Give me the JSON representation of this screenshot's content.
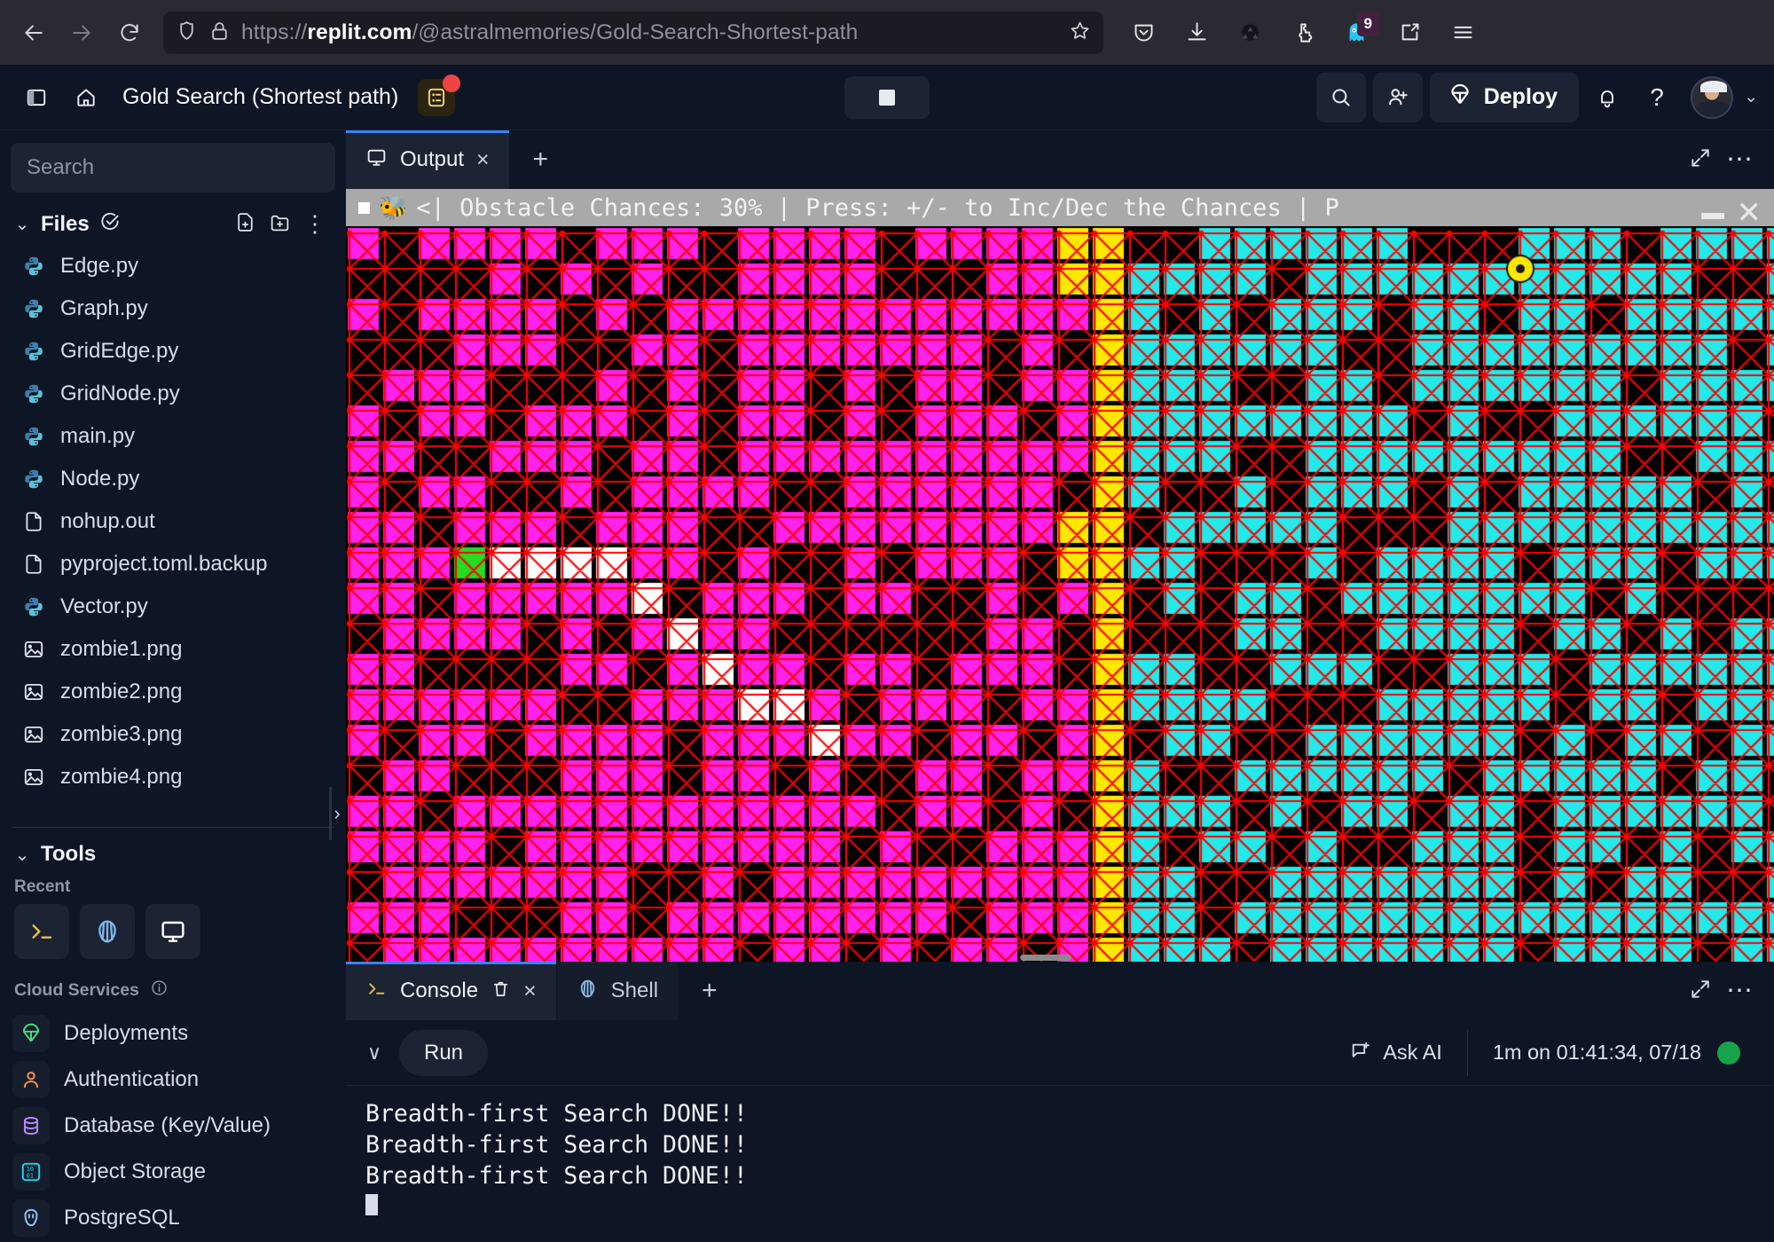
{
  "browser": {
    "url_prefix": "https://",
    "url_domain": "replit.com",
    "url_path": "/@astralmemories/Gold-Search-Shortest-path",
    "url_full": "https://replit.com/@astralmemories/Gold-Search-Shortest-path",
    "back_icon": "back-arrow-icon",
    "forward_icon": "forward-arrow-icon",
    "reload_icon": "reload-icon",
    "shield_icon": "shield-icon",
    "lock_icon": "lock-icon",
    "star_icon": "bookmark-star-icon",
    "toolbar_icons": [
      "pocket-icon",
      "download-icon",
      "extension-circle-icon",
      "puzzle-extensions-icon",
      "ghost-proxy-icon",
      "open-in-new-icon",
      "hamburger-menu-icon"
    ],
    "ghost_badge": "9"
  },
  "header": {
    "sidebar_toggle_icon": "sidebar-toggle-icon",
    "home_icon": "home-icon",
    "title": "Gold Search (Shortest path)",
    "changes_icon": "git-changes-icon",
    "stop_icon": "stop-square-icon",
    "search_icon": "search-icon",
    "invite_icon": "invite-user-icon",
    "deploy_icon": "deploy-parachute-icon",
    "deploy_label": "Deploy",
    "bell_icon": "bell-icon",
    "help_label": "?",
    "avatar_icon": "avatar",
    "avatar_caret": "⌄"
  },
  "sidebar": {
    "search_placeholder": "Search",
    "search_value": "",
    "files_title": "Files",
    "files_check_icon": "check-circle-icon",
    "new_file_icon": "new-file-icon",
    "new_folder_icon": "new-folder-icon",
    "files_more_icon": "more-vertical-icon",
    "files": [
      {
        "name": "Edge.py",
        "type": "python"
      },
      {
        "name": "Graph.py",
        "type": "python"
      },
      {
        "name": "GridEdge.py",
        "type": "python"
      },
      {
        "name": "GridNode.py",
        "type": "python"
      },
      {
        "name": "main.py",
        "type": "python"
      },
      {
        "name": "Node.py",
        "type": "python"
      },
      {
        "name": "nohup.out",
        "type": "file"
      },
      {
        "name": "pyproject.toml.backup",
        "type": "file"
      },
      {
        "name": "Vector.py",
        "type": "python"
      },
      {
        "name": "zombie1.png",
        "type": "image"
      },
      {
        "name": "zombie2.png",
        "type": "image"
      },
      {
        "name": "zombie3.png",
        "type": "image"
      },
      {
        "name": "zombie4.png",
        "type": "image"
      }
    ],
    "tools_title": "Tools",
    "recent_label": "Recent",
    "recent_tools": [
      "console-icon",
      "shell-icon",
      "output-monitor-icon"
    ],
    "cloud_services_label": "Cloud Services",
    "cloud_info_icon": "info-icon",
    "cloud_services": [
      {
        "label": "Deployments",
        "icon": "deploy-parachute-icon",
        "color": "#4ade80"
      },
      {
        "label": "Authentication",
        "icon": "user-icon",
        "color": "#fb923c"
      },
      {
        "label": "Database (Key/Value)",
        "icon": "database-icon",
        "color": "#c084fc"
      },
      {
        "label": "Object Storage",
        "icon": "binary-storage-icon",
        "color": "#22d3ee"
      },
      {
        "label": "PostgreSQL",
        "icon": "postgres-elephant-icon",
        "color": "#93c5fd"
      }
    ],
    "expand_handle_icon": "chevron-right-icon"
  },
  "output_panel": {
    "tab_label": "Output",
    "tab_icon": "monitor-icon",
    "tab_close": "×",
    "add_tab": "+",
    "expand_icon": "expand-icon",
    "more_icon": "more-horizontal-icon",
    "pygame_title": "<| Obstacle Chances: 30% | Press: +/- to Inc/Dec the Chances | P",
    "pygame_emoji": "🐝",
    "minimize_icon": "minimize-icon",
    "close_icon": "close-icon"
  },
  "console_panel": {
    "console_tab": "Console",
    "console_icon": "console-prompt-icon",
    "trash_icon": "trash-icon",
    "close_icon": "×",
    "shell_tab": "Shell",
    "shell_icon": "shell-icon",
    "add_tab": "+",
    "expand_icon": "expand-icon",
    "more_icon": "more-horizontal-icon",
    "collapse_caret": "∨",
    "run_label": "Run",
    "ask_ai_label": "Ask AI",
    "ask_ai_icon": "ask-ai-icon",
    "timestamp": "1m on 01:41:34, 07/18",
    "status_color": "#16a34a",
    "output_lines": [
      "Breadth-first Search DONE!!",
      "Breadth-first Search DONE!!",
      "Breadth-first Search DONE!!"
    ]
  },
  "grid_visual": {
    "cols": 47,
    "rows": 27,
    "cell": 40,
    "colors": {
      "background": "#000000",
      "obstacle": "#ff22ee",
      "visited": "#22eaea",
      "path": "#ffe800",
      "start": "#22dd22",
      "frontier": "#ffffff",
      "edge": "#ff0000",
      "node": "#ff0000"
    },
    "goal_marker_color": "#ffe800",
    "legend": {
      "magenta": "obstacle cells",
      "cyan": "visited cells",
      "yellow": "shortest path",
      "green": "start node",
      "white": "explored path cells"
    }
  }
}
